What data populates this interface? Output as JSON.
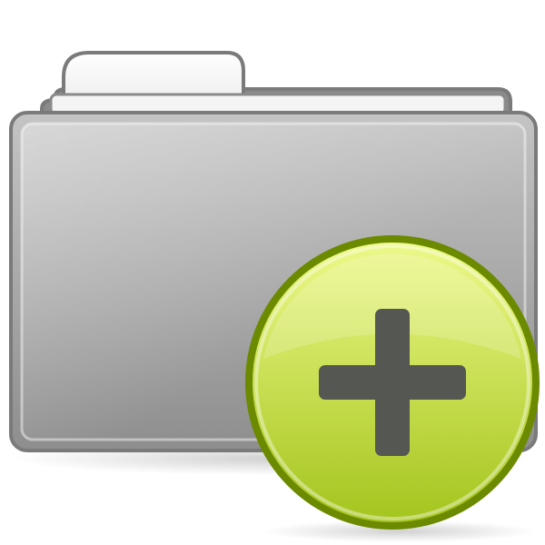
{
  "icon": {
    "name": "folder-new-icon",
    "folder": {
      "body_color": "#a9a9a9",
      "body_light": "#c4c4c4",
      "body_dark": "#8e8e8e",
      "outline_color": "#7a7a7a",
      "tab_color": "#efefef",
      "back_color": "#8a8a8a"
    },
    "badge": {
      "name": "add-badge",
      "fill_top": "#eef98a",
      "fill_bottom": "#a3c41c",
      "ring_color": "#6b8a00",
      "plus_color": "#555753"
    }
  }
}
